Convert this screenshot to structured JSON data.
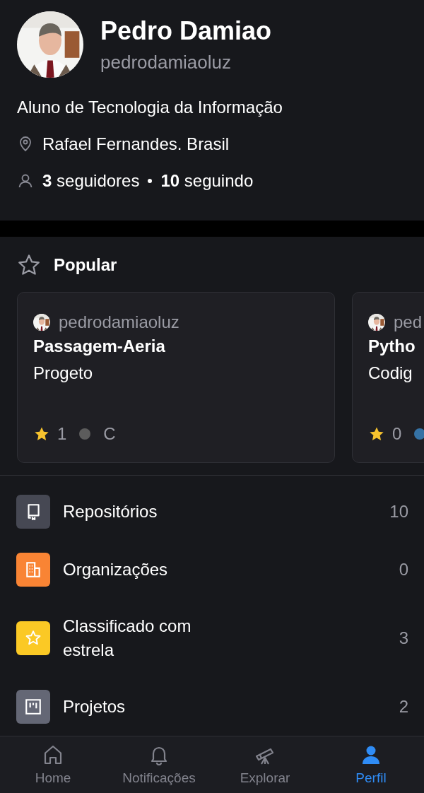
{
  "profile": {
    "name": "Pedro Damiao",
    "username": "pedrodamiaoluz",
    "bio": "Aluno de Tecnologia da Informação",
    "location": "Rafael Fernandes. Brasil",
    "followers": "**3** seguidores",
    "following": "**10** seguindo"
  },
  "popular": {
    "title": "Popular",
    "cards": [
      {
        "owner": "pedrodamiaoluz",
        "name": "Passagem-Aeria",
        "description": "Progeto",
        "stars": "1",
        "language": "C",
        "color": "#5c5c5c"
      },
      {
        "owner": "ped",
        "name": "Pytho",
        "description": "Codig",
        "stars": "0",
        "color": "#3572a5"
      }
    ]
  },
  "menu": [
    {
      "kind": "repo",
      "label": "Repositórios",
      "count": "10",
      "color": "#464853"
    },
    {
      "kind": "org",
      "label": "Organizações",
      "count": "0",
      "color": "#f98434"
    },
    {
      "kind": "star",
      "label": "Classificado com estrela",
      "count": "3",
      "color": "#fbc925"
    },
    {
      "kind": "project",
      "label": "Projetos",
      "count": "2",
      "color": "#646775"
    }
  ],
  "nav": [
    {
      "kind": "home",
      "label": "Home",
      "selected": false
    },
    {
      "kind": "bell",
      "label": "Notificações",
      "selected": false
    },
    {
      "kind": "telescope",
      "label": "Explorar",
      "selected": false
    },
    {
      "kind": "person",
      "label": "Perfil",
      "selected": true
    }
  ]
}
